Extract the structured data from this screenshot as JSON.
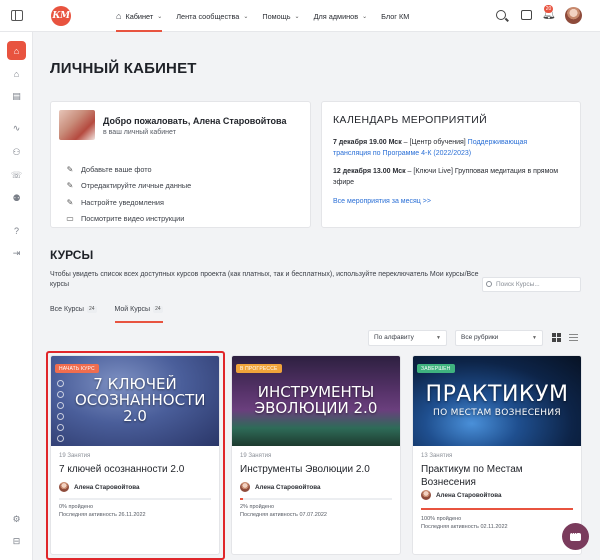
{
  "nav": {
    "logo_text": "КМ",
    "items": [
      {
        "label": "Кабинет",
        "chevron": true,
        "active": true
      },
      {
        "label": "Лента сообщества",
        "chevron": true
      },
      {
        "label": "Помощь",
        "chevron": true
      },
      {
        "label": "Для админов",
        "chevron": true
      },
      {
        "label": "Блог КМ",
        "chevron": false
      }
    ],
    "notification_count": "20"
  },
  "page": {
    "title": "ЛИЧНЫЙ КАБИНЕТ"
  },
  "welcome": {
    "title": "Добро пожаловать,  Алена Старовойтова",
    "subtitle": "в ваш личный кабинет",
    "links": [
      {
        "label": "Добавьте ваше фото",
        "icon": "pencil-icon"
      },
      {
        "label": "Отредактируйте личные данные",
        "icon": "pencil-icon"
      },
      {
        "label": "Настройте уведомления",
        "icon": "pencil-icon"
      },
      {
        "label": "Посмотрите видео инструкции",
        "icon": "video-icon"
      }
    ]
  },
  "calendar": {
    "title": "КАЛЕНДАРЬ МЕРОПРИЯТИЙ",
    "events": [
      {
        "when": "7 декабря 19.00 Мск",
        "text": " – [Центр обучения] ",
        "link": "Поддерживающая трансляция по Программе 4-К (2022/2023)"
      },
      {
        "when": "12 декабря 13.00 Мск",
        "text": " – [Ключи Live] Групповая медитация в прямом эфире",
        "link": ""
      }
    ],
    "all_link": "Все мероприятия за месяц >>"
  },
  "courses": {
    "title": "КУРСЫ",
    "description": "Чтобы увидеть список всех доступных курсов проекта (как платных, так и бесплатных), используйте переключатель Мои курсы/Все курсы",
    "search_placeholder": "Поиск Курсы...",
    "tabs": [
      {
        "label": "Все Курсы",
        "count": "24"
      },
      {
        "label": "Мой Курсы",
        "count": "24",
        "active": true
      }
    ],
    "sort_value": "По алфавиту",
    "category_value": "Все рубрики",
    "cards": [
      {
        "status": "НАЧАТЬ КУРС",
        "status_color": "#f06d4f",
        "banner_title": "7 КЛЮЧЕЙ ОСОЗНАННОСТИ 2.0",
        "banner_sub": "",
        "lessons": "19 Занятия",
        "title": "7 ключей осознанности 2.0",
        "author": "Алена Старовойтова",
        "progress": 0,
        "progress_label": "0% пройдено",
        "activity": "Последняя активность 26.11.2022"
      },
      {
        "status": "В ПРОГРЕССЕ",
        "status_color": "#f0a43a",
        "banner_title": "ИНСТРУМЕНТЫ ЭВОЛЮЦИИ 2.0",
        "banner_sub": "",
        "lessons": "19 Занятия",
        "title": "Инструменты Эволюции 2.0",
        "author": "Алена Старовойтова",
        "progress": 2,
        "progress_label": "2% пройдено",
        "activity": "Последняя активность 07.07.2022"
      },
      {
        "status": "ЗАВЕРШЕН",
        "status_color": "#3fb37f",
        "banner_title": "ПРАКТИКУМ",
        "banner_sub": "ПО МЕСТАМ ВОЗНЕСЕНИЯ",
        "lessons": "13 Занятия",
        "title": "Практикум по Местам Вознесения",
        "author": "Алена Старовойтова",
        "progress": 100,
        "progress_label": "100% пройдено",
        "activity": "Последняя активность 02.11.2022"
      }
    ]
  },
  "colors": {
    "accent": "#e8533f",
    "link": "#2a6fd6",
    "highlight": "#e0262a",
    "chat": "#7a3b5c"
  }
}
